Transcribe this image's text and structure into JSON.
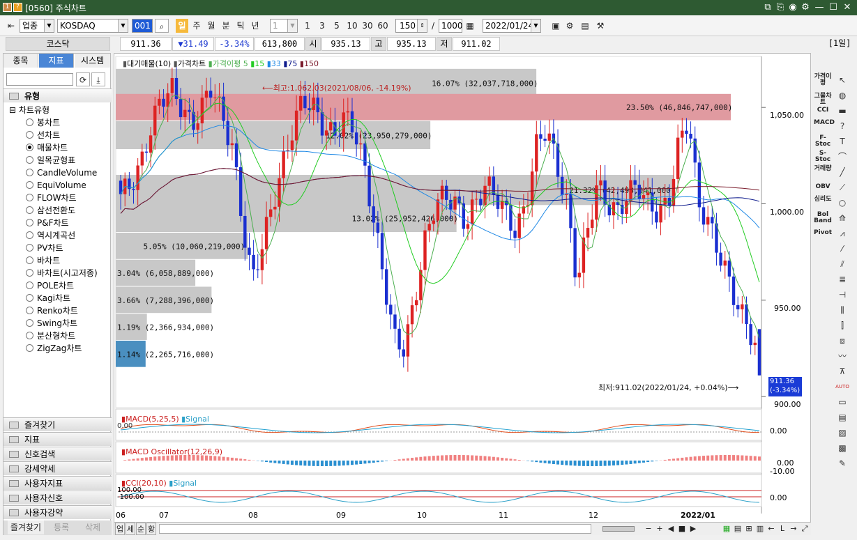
{
  "window": {
    "title": "[0560] 주식차트",
    "icon1": "1",
    "icon2": "?"
  },
  "toolbar": {
    "category": "업종",
    "symbol": "KOSDAQ",
    "code_field": "001",
    "periods": [
      "일",
      "주",
      "월",
      "분",
      "틱",
      "년"
    ],
    "interval_value": "1",
    "quick_intervals": [
      "1",
      "3",
      "5",
      "10",
      "30",
      "60"
    ],
    "count": "150",
    "total": "1000",
    "date": "2022/01/24"
  },
  "info": {
    "name": "코스닥",
    "price": "911.36",
    "change": "▼31.49",
    "pct": "-3.34%",
    "volume": "613,800",
    "open_label": "시",
    "open": "935.13",
    "high_label": "고",
    "high": "935.13",
    "low_label": "저",
    "low": "911.02",
    "period_badge": "[1일]"
  },
  "left": {
    "tabs": [
      "종목",
      "지표",
      "시스템"
    ],
    "type_header": "유형",
    "chart_type_label": "차트유형",
    "chart_types": [
      "봉차트",
      "선차트",
      "매물차트",
      "일목균형표",
      "CandleVolume",
      "EquiVolume",
      "FLOW차트",
      "삼선전환도",
      "P&F차트",
      "역시계곡선",
      "PV차트",
      "바차트",
      "바차트(시고저종)",
      "POLE차트",
      "Kagi차트",
      "Renko차트",
      "Swing차트",
      "분산형차트",
      "ZigZag차트"
    ],
    "selected_type": "매물차트",
    "sections": [
      "즐겨찾기",
      "지표",
      "신호검색",
      "강세약세",
      "사용자지표",
      "사용자신호",
      "사용자강약"
    ],
    "bottom_tabs": [
      "즐겨찾기",
      "등록",
      "삭제"
    ]
  },
  "chart": {
    "legend": {
      "volume_profile": "대기매물(10)",
      "price_chart": "가격차트",
      "ma_label": "가격이평",
      "ma": [
        "5",
        "15",
        "33",
        "75",
        "150"
      ]
    },
    "ma_colors": [
      "#4caf50",
      "#22cc22",
      "#1e88e5",
      "#0d1a8c",
      "#7a1a2a"
    ],
    "high_annotation": "최고:1,062.03(2021/08/06, -14.19%)",
    "low_annotation": "최저:911.02(2022/01/24, +0.04%)",
    "current_price_tag": "911.36",
    "current_change_tag": "(-3.34%)",
    "price_ticks": [
      "1,050.00",
      "1,000.00",
      "950.00",
      "900.00"
    ],
    "volume_profile": [
      {
        "label": "16.07% (32,037,718,000)",
        "pct": 16.07,
        "color": "#c8c8c8"
      },
      {
        "label": "23.50% (46,846,747,000)",
        "pct": 23.5,
        "color": "#e09aa0"
      },
      {
        "label": "12.02% (23,950,279,000)",
        "pct": 12.02,
        "color": "#c8c8c8"
      },
      {
        "label": "21.32% (42,498,041,000)",
        "pct": 21.32,
        "color": "#c8c8c8"
      },
      {
        "label": "13.02% (25,952,426,000)",
        "pct": 13.02,
        "color": "#c8c8c8"
      },
      {
        "label": "5.05% (10,060,219,000)",
        "pct": 5.05,
        "color": "#c8c8c8"
      },
      {
        "label": "3.04% (6,058,889,000)",
        "pct": 3.04,
        "color": "#c8c8c8"
      },
      {
        "label": "3.66% (7,288,396,000)",
        "pct": 3.66,
        "color": "#c8c8c8"
      },
      {
        "label": "1.19% (2,366,934,000)",
        "pct": 1.19,
        "color": "#c8c8c8"
      },
      {
        "label": "1.14% (2,265,716,000)",
        "pct": 1.14,
        "color": "#4a8fc0"
      }
    ],
    "macd": {
      "label": "MACD(5,25,5)",
      "signal": "Signal",
      "zero": "0.00",
      "tick": "0.00"
    },
    "macd_osc": {
      "label": "MACD Oscillator(12,26,9)",
      "ticks": [
        "0.00",
        "-10.00"
      ]
    },
    "cci": {
      "label": "CCI(20,10)",
      "signal": "Signal",
      "hi": "100.00",
      "lo": "-100.00",
      "tick": "0.00"
    },
    "months": [
      "06",
      "07",
      "08",
      "09",
      "10",
      "11",
      "12",
      "2022/01"
    ],
    "bottom_btns": [
      "업",
      "세",
      "순",
      "황"
    ]
  },
  "right": {
    "indicators": [
      "가격이평",
      "그물차트",
      "CCI",
      "MACD",
      "F-Stoc",
      "S-Stoc",
      "거래량",
      "OBV",
      "심리도",
      "Bol Band",
      "Pivot"
    ]
  }
}
